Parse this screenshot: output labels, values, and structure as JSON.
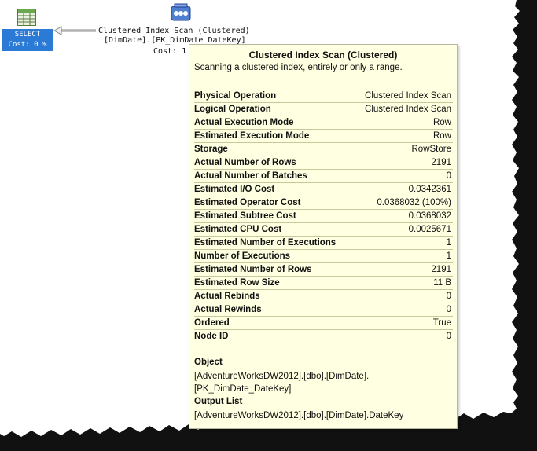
{
  "select_node": {
    "label_line1": "SELECT",
    "label_line2": "Cost: 0 %",
    "icon": "result-grid-icon"
  },
  "scan_node": {
    "icon": "clustered-index-scan-icon",
    "line1": "Clustered Index Scan (Clustered)",
    "line2": "[DimDate].[PK_DimDate_DateKey]",
    "line3": "Cost: 1"
  },
  "tooltip": {
    "title": "Clustered Index Scan (Clustered)",
    "description": "Scanning a clustered index, entirely or only a range.",
    "properties": [
      {
        "name": "Physical Operation",
        "value": "Clustered Index Scan"
      },
      {
        "name": "Logical Operation",
        "value": "Clustered Index Scan"
      },
      {
        "name": "Actual Execution Mode",
        "value": "Row"
      },
      {
        "name": "Estimated Execution Mode",
        "value": "Row"
      },
      {
        "name": "Storage",
        "value": "RowStore"
      },
      {
        "name": "Actual Number of Rows",
        "value": "2191"
      },
      {
        "name": "Actual Number of Batches",
        "value": "0"
      },
      {
        "name": "Estimated I/O Cost",
        "value": "0.0342361"
      },
      {
        "name": "Estimated Operator Cost",
        "value": "0.0368032 (100%)"
      },
      {
        "name": "Estimated Subtree Cost",
        "value": "0.0368032"
      },
      {
        "name": "Estimated CPU Cost",
        "value": "0.0025671"
      },
      {
        "name": "Estimated Number of Executions",
        "value": "1"
      },
      {
        "name": "Number of Executions",
        "value": "1"
      },
      {
        "name": "Estimated Number of Rows",
        "value": "2191"
      },
      {
        "name": "Estimated Row Size",
        "value": "11 B"
      },
      {
        "name": "Actual Rebinds",
        "value": "0"
      },
      {
        "name": "Actual Rewinds",
        "value": "0"
      },
      {
        "name": "Ordered",
        "value": "True"
      },
      {
        "name": "Node ID",
        "value": "0"
      }
    ],
    "object_heading": "Object",
    "object_line1": "[AdventureWorksDW2012].[dbo].[DimDate].",
    "object_line2": "[PK_DimDate_DateKey]",
    "output_heading": "Output List",
    "output_line1": "[AdventureWorksDW2012].[dbo].[DimDate].DateKey"
  },
  "colors": {
    "tooltip_bg": "#ffffe1",
    "select_highlight": "#2b7bd6",
    "row_rule": "#c8c89a"
  }
}
